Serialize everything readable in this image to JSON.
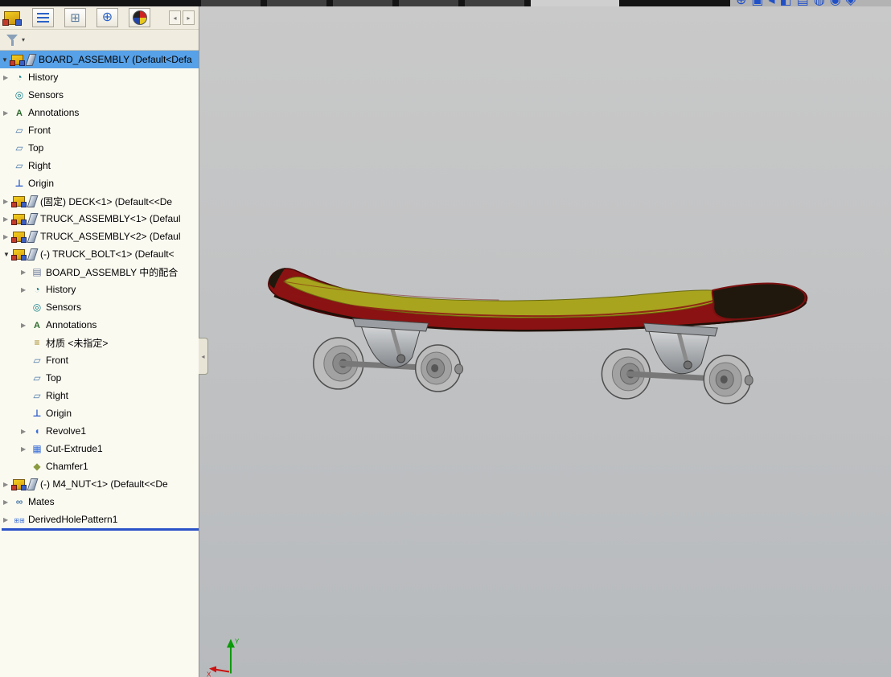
{
  "titlebar": {
    "segments": [
      "dark",
      "dark",
      "dark",
      "dark",
      "dark",
      "light"
    ]
  },
  "headsup": {
    "icons": [
      {
        "name": "zoom-to-fit",
        "glyph": "⊕"
      },
      {
        "name": "zoom-to-area",
        "glyph": "▣"
      },
      {
        "name": "previous-view",
        "glyph": "◂"
      },
      {
        "name": "section-view",
        "glyph": "◧"
      },
      {
        "name": "view-orientation",
        "glyph": "▤"
      },
      {
        "name": "display-style",
        "glyph": "◍"
      },
      {
        "name": "hide-show-items",
        "glyph": "◉"
      },
      {
        "name": "scene-settings",
        "glyph": "◈"
      }
    ]
  },
  "panel": {
    "tabs": [
      {
        "name": "featuremanager",
        "glyph": ""
      },
      {
        "name": "propertymanager",
        "glyph": "⊞"
      },
      {
        "name": "configurationmanager",
        "glyph": "⊕"
      },
      {
        "name": "displaymanager",
        "glyph": ""
      }
    ],
    "scroll_left": "◂",
    "scroll_right": "▸",
    "filter_dropdown": "▾",
    "collapse_glyph": "◂"
  },
  "tree": {
    "items": [
      {
        "id": "board-assembly",
        "label": "BOARD_ASSEMBLY  (Default<Defa",
        "indent": 0,
        "expand": "open",
        "icons": [
          "ic-asm",
          "ic-feather"
        ],
        "selected": true
      },
      {
        "id": "history",
        "label": "History",
        "indent": 1,
        "expand": "closed",
        "icons": [
          "ic-history"
        ]
      },
      {
        "id": "sensors",
        "label": "Sensors",
        "indent": 1,
        "expand": "none",
        "icons": [
          "ic-sensors"
        ]
      },
      {
        "id": "annotations",
        "label": "Annotations",
        "indent": 1,
        "expand": "closed",
        "icons": [
          "ic-annot"
        ]
      },
      {
        "id": "front-plane",
        "label": "Front",
        "indent": 1,
        "expand": "none",
        "icons": [
          "ic-plane"
        ]
      },
      {
        "id": "top-plane",
        "label": "Top",
        "indent": 1,
        "expand": "none",
        "icons": [
          "ic-plane"
        ]
      },
      {
        "id": "right-plane",
        "label": "Right",
        "indent": 1,
        "expand": "none",
        "icons": [
          "ic-plane"
        ]
      },
      {
        "id": "origin",
        "label": "Origin",
        "indent": 1,
        "expand": "none",
        "icons": [
          "ic-origin"
        ]
      },
      {
        "id": "deck",
        "label": "(固定) DECK<1> (Default<<De",
        "indent": 1,
        "expand": "closed",
        "icons": [
          "ic-asm",
          "ic-feather"
        ]
      },
      {
        "id": "truck-assembly-1",
        "label": "TRUCK_ASSEMBLY<1> (Defaul",
        "indent": 1,
        "expand": "closed",
        "icons": [
          "ic-asm",
          "ic-feather"
        ]
      },
      {
        "id": "truck-assembly-2",
        "label": "TRUCK_ASSEMBLY<2> (Defaul",
        "indent": 1,
        "expand": "closed",
        "icons": [
          "ic-asm",
          "ic-feather"
        ]
      },
      {
        "id": "truck-bolt",
        "label": "(-) TRUCK_BOLT<1> (Default<",
        "indent": 1,
        "expand": "open",
        "icons": [
          "ic-asm",
          "ic-feather"
        ]
      },
      {
        "id": "mates-in-board-assembly",
        "label": "BOARD_ASSEMBLY 中的配合",
        "indent": 2,
        "expand": "closed",
        "icons": [
          "ic-matefolder"
        ]
      },
      {
        "id": "history-sub",
        "label": "History",
        "indent": 2,
        "expand": "closed",
        "icons": [
          "ic-history"
        ]
      },
      {
        "id": "sensors-sub",
        "label": "Sensors",
        "indent": 2,
        "expand": "none",
        "icons": [
          "ic-sensors"
        ]
      },
      {
        "id": "annotations-sub",
        "label": "Annotations",
        "indent": 2,
        "expand": "closed",
        "icons": [
          "ic-annot"
        ]
      },
      {
        "id": "material",
        "label": "材质 <未指定>",
        "indent": 2,
        "expand": "none",
        "icons": [
          "ic-material"
        ]
      },
      {
        "id": "front-plane-sub",
        "label": "Front",
        "indent": 2,
        "expand": "none",
        "icons": [
          "ic-plane"
        ]
      },
      {
        "id": "top-plane-sub",
        "label": "Top",
        "indent": 2,
        "expand": "none",
        "icons": [
          "ic-plane"
        ]
      },
      {
        "id": "right-plane-sub",
        "label": "Right",
        "indent": 2,
        "expand": "none",
        "icons": [
          "ic-plane"
        ]
      },
      {
        "id": "origin-sub",
        "label": "Origin",
        "indent": 2,
        "expand": "none",
        "icons": [
          "ic-origin"
        ]
      },
      {
        "id": "revolve1",
        "label": "Revolve1",
        "indent": 2,
        "expand": "closed",
        "icons": [
          "ic-revolve"
        ]
      },
      {
        "id": "cut-extrude1",
        "label": "Cut-Extrude1",
        "indent": 2,
        "expand": "closed",
        "icons": [
          "ic-cut"
        ]
      },
      {
        "id": "chamfer1",
        "label": "Chamfer1",
        "indent": 2,
        "expand": "none",
        "icons": [
          "ic-chamfer"
        ]
      },
      {
        "id": "m4-nut",
        "label": "(-) M4_NUT<1> (Default<<De",
        "indent": 1,
        "expand": "closed",
        "icons": [
          "ic-asm",
          "ic-feather"
        ]
      },
      {
        "id": "mates",
        "label": "Mates",
        "indent": 1,
        "expand": "closed",
        "icons": [
          "ic-mates"
        ]
      },
      {
        "id": "derived-hole-pattern1",
        "label": "DerivedHolePattern1",
        "indent": 1,
        "expand": "closed",
        "icons": [
          "ic-dhp"
        ]
      }
    ]
  },
  "colors": {
    "selection": "#57a1e8",
    "deck_top": "#a8a41e",
    "deck_rim": "#8a1212",
    "deck_dark": "#20180c",
    "wheel": "#bcbcbc",
    "truck": "#9a9ea2",
    "viewport_top": "#c9c9c9",
    "viewport_bottom": "#b7babd",
    "rollback": "#2a52c8"
  },
  "viewport": {
    "triad": {
      "x_label": "X",
      "y_label": "Y"
    }
  }
}
